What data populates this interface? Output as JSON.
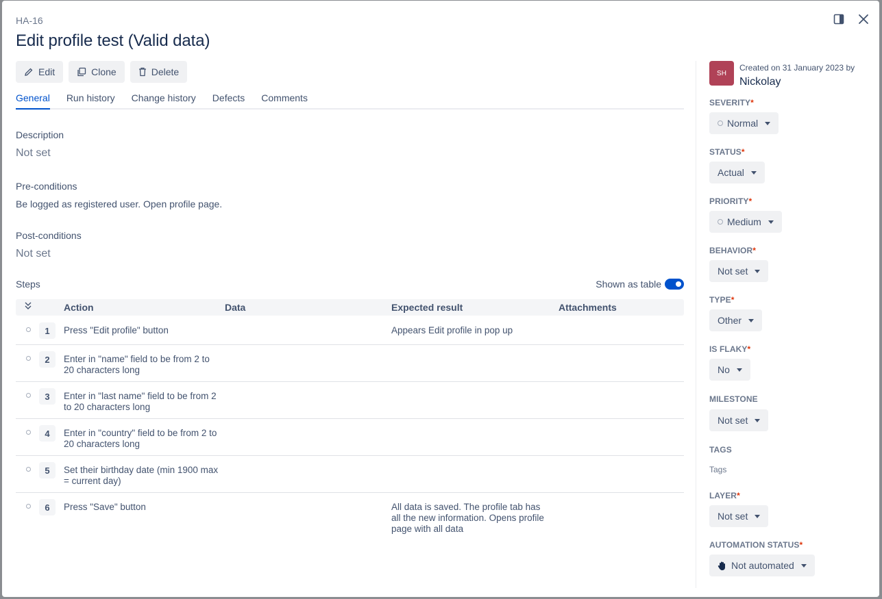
{
  "header": {
    "key": "HA-16",
    "title": "Edit profile test (Valid data)"
  },
  "toolbar": {
    "edit": "Edit",
    "clone": "Clone",
    "delete": "Delete"
  },
  "tabs": [
    "General",
    "Run history",
    "Change history",
    "Defects",
    "Comments"
  ],
  "general": {
    "description_label": "Description",
    "description_value": "Not set",
    "preconditions_label": "Pre-conditions",
    "preconditions_value": "Be logged as registered user. Open profile page.",
    "postconditions_label": "Post-conditions",
    "postconditions_value": "Not set",
    "steps_label": "Steps",
    "shown_as_table": "Shown as table"
  },
  "steps_table": {
    "columns": {
      "action": "Action",
      "data": "Data",
      "expected": "Expected result",
      "attachments": "Attachments"
    },
    "rows": [
      {
        "num": "1",
        "action": "Press \"Edit profile\" button",
        "expected": "Appears Edit profile in pop up"
      },
      {
        "num": "2",
        "action": "Enter in \"name\" field to be from 2 to 20 characters long",
        "expected": ""
      },
      {
        "num": "3",
        "action": "Enter in \"last name\" field to be from 2 to 20 characters long",
        "expected": ""
      },
      {
        "num": "4",
        "action": "Enter in \"country\" field to be from 2 to 20 characters long",
        "expected": ""
      },
      {
        "num": "5",
        "action": "Set their birthday date (min 1900 max = current day)",
        "expected": ""
      },
      {
        "num": "6",
        "action": "Press \"Save\" button",
        "expected": "All data is saved. The profile tab has all the new information. Opens profile page with all data"
      }
    ]
  },
  "sidebar": {
    "avatar_initials": "SH",
    "created_text": "Created on 31 January 2023 by",
    "author": "Nickolay",
    "severity_label": "SEVERITY",
    "severity_value": "Normal",
    "status_label": "STATUS",
    "status_value": "Actual",
    "priority_label": "PRIORITY",
    "priority_value": "Medium",
    "behavior_label": "BEHAVIOR",
    "behavior_value": "Not set",
    "type_label": "TYPE",
    "type_value": "Other",
    "flaky_label": "IS FLAKY",
    "flaky_value": "No",
    "milestone_label": "MILESTONE",
    "milestone_value": "Not set",
    "tags_label": "TAGS",
    "tags_value": "Tags",
    "layer_label": "LAYER",
    "layer_value": "Not set",
    "automation_label": "AUTOMATION STATUS",
    "automation_value": "Not automated",
    "required_mark": "*"
  },
  "colors": {
    "accent": "#0052cc",
    "avatar_bg": "#b04257",
    "required": "#de350b"
  }
}
